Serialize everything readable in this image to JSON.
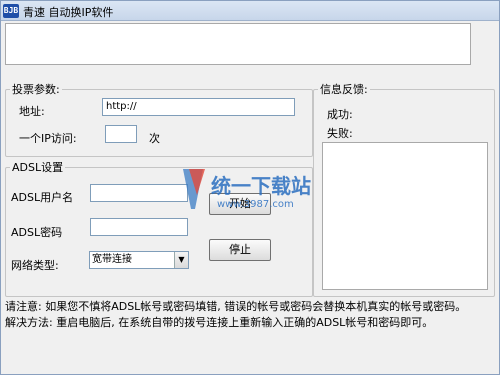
{
  "window": {
    "icon_text": "BJB",
    "title": "青速 自动换IP软件"
  },
  "vote_params": {
    "legend": "投票参数:",
    "address_label": "地址:",
    "address_value": "http://",
    "visits_label": "一个IP访问:",
    "visits_value": "",
    "visits_unit": "次"
  },
  "feedback": {
    "legend": "信息反馈:",
    "success_label": "成功:",
    "fail_label": "失败:"
  },
  "adsl": {
    "legend": "ADSL设置",
    "user_label": "ADSL用户名",
    "user_value": "",
    "password_label": "ADSL密码",
    "password_value": "",
    "network_label": "网络类型:",
    "network_selected": "宽带连接",
    "start_button": "开始",
    "stop_button": "停止"
  },
  "notes": {
    "line1": "请注意: 如果您不慎将ADSL帐号或密码填错, 错误的帐号或密码会替换本机真实的帐号或密码。",
    "line2": "解决方法: 重启电脑后, 在系统自带的拨号连接上重新输入正确的ADSL帐号和密码即可。"
  },
  "watermark": {
    "brand": "统一下载站",
    "url": "www.3987.com"
  }
}
